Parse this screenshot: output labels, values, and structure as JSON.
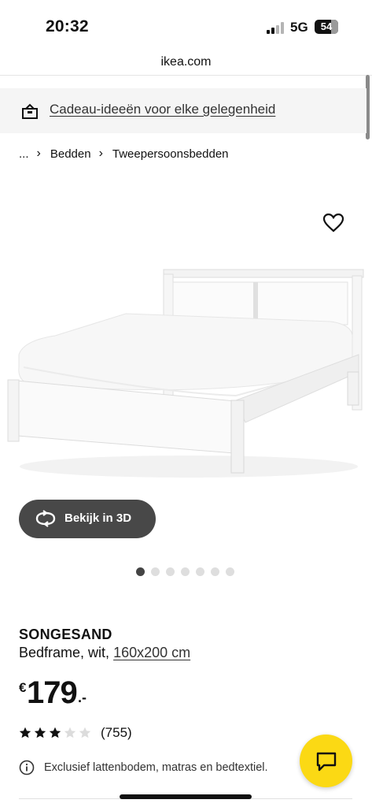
{
  "status_bar": {
    "time": "20:32",
    "network": "5G",
    "battery": "54"
  },
  "browser": {
    "url": "ikea.com"
  },
  "promo": {
    "icon": "gift-box-icon",
    "text": "Cadeau-ideeën voor elke gelegenheid"
  },
  "breadcrumb": {
    "items": [
      "...",
      "Bedden",
      "Tweepersoonsbedden"
    ]
  },
  "gallery": {
    "view_3d_label": "Bekijk in 3D",
    "image_count": 7,
    "active_index": 0
  },
  "product": {
    "name": "SONGESAND",
    "description": "Bedframe, wit,",
    "size": "160x200 cm",
    "price": {
      "currency": "€",
      "value": "179",
      "suffix": ".-"
    },
    "rating": {
      "stars": 3.5,
      "max": 5,
      "count": "(755)"
    },
    "notice": "Exclusief lattenbodem, matras en bedtextiel."
  },
  "colors": {
    "promo_bg": "#f5f5f5",
    "chat_button": "#fbd914",
    "view_3d_button": "#484848"
  }
}
